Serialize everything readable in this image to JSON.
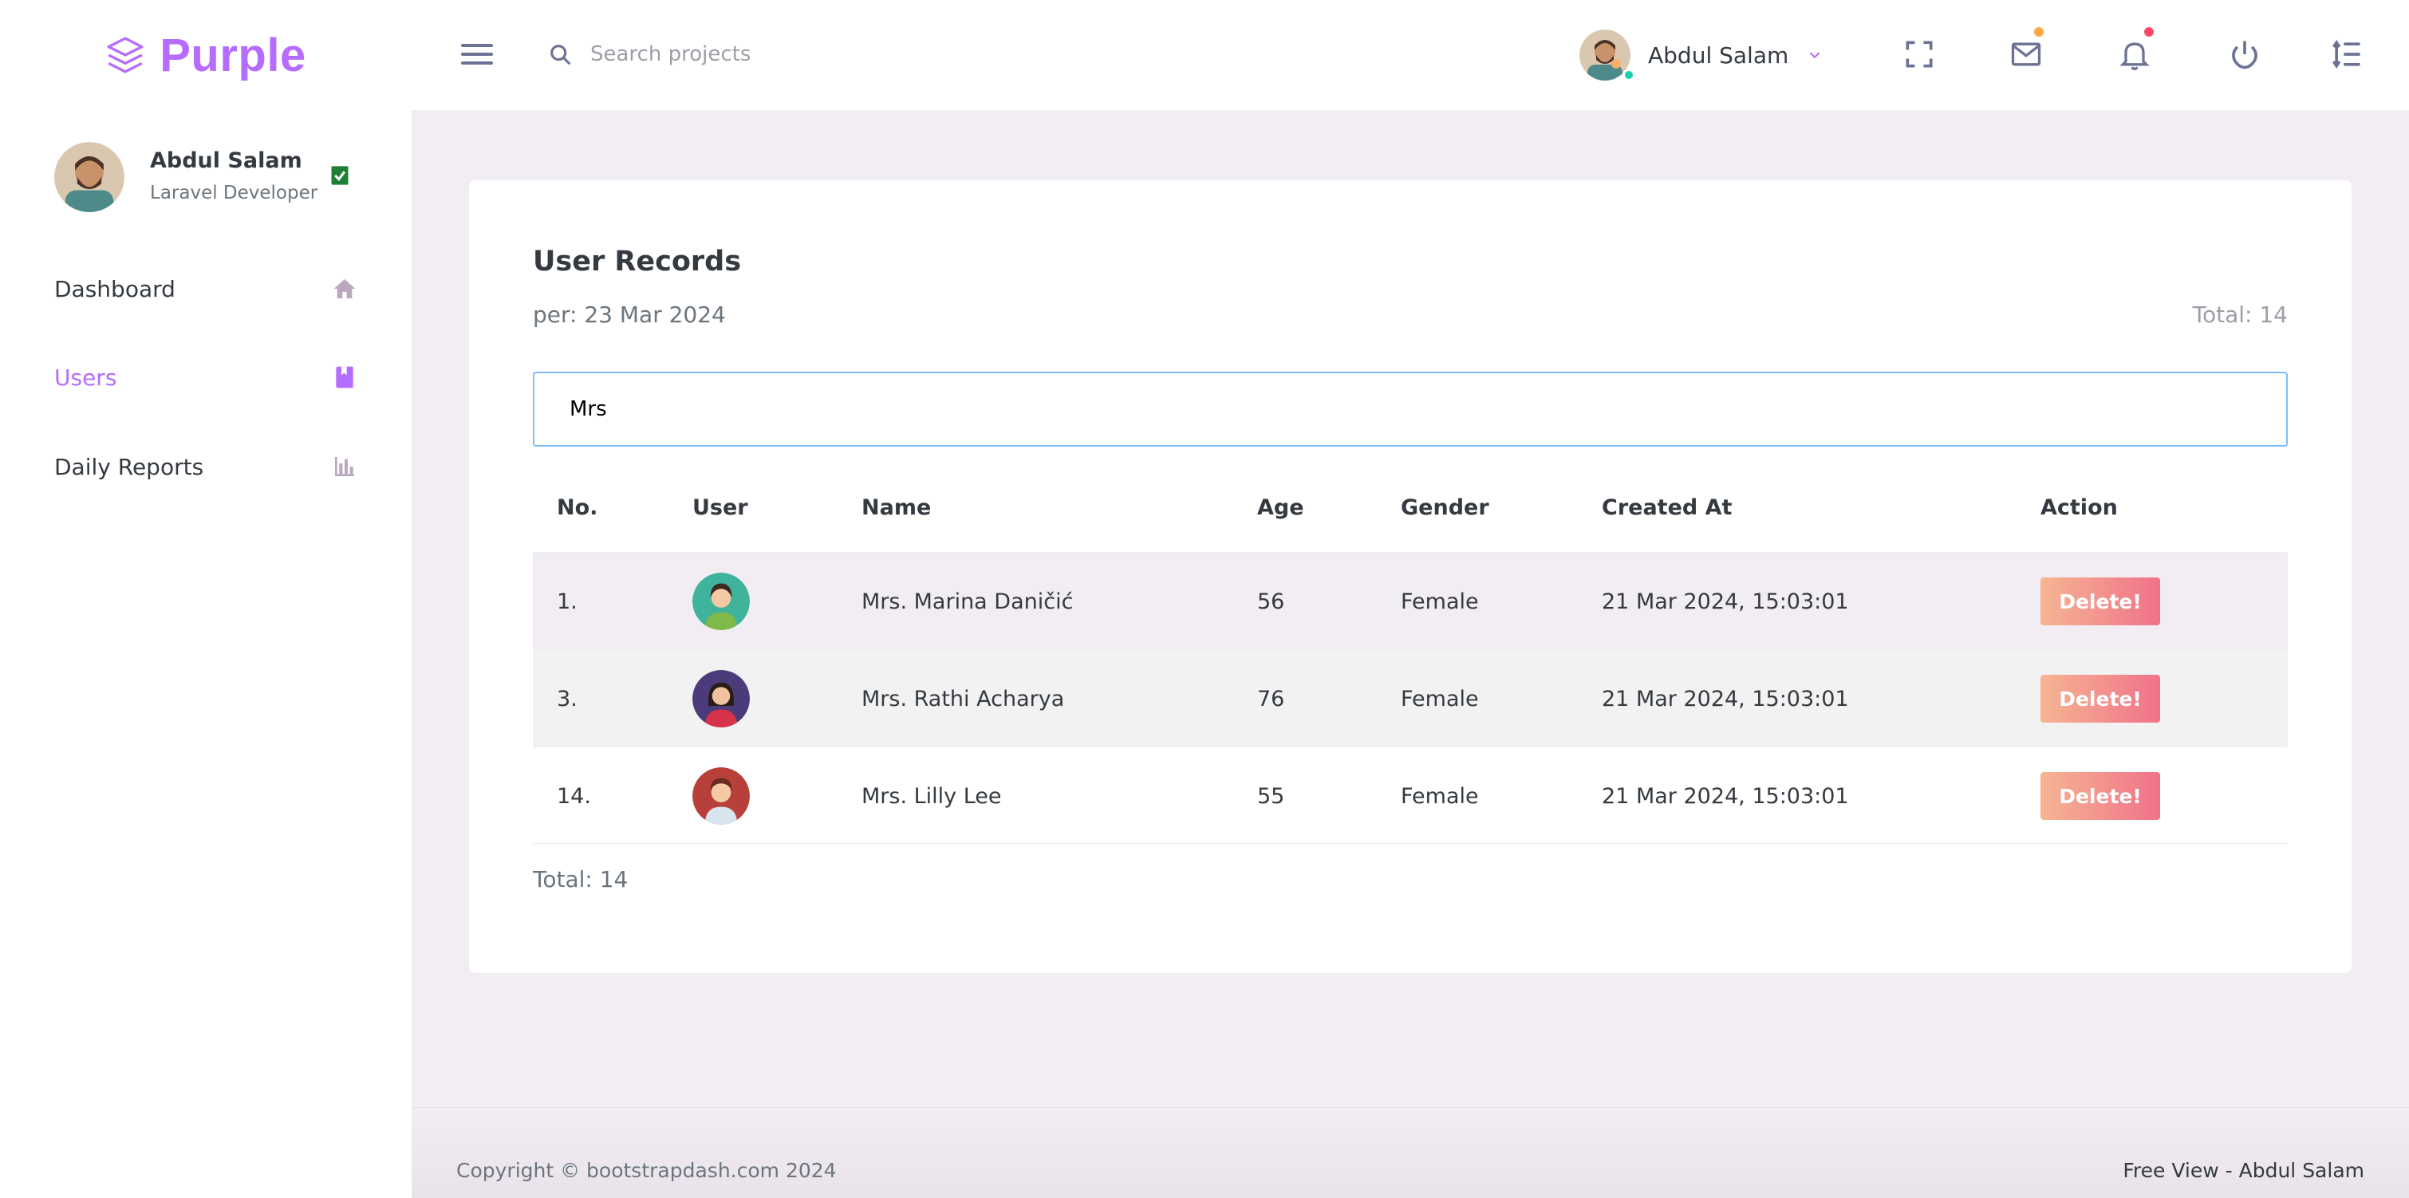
{
  "brand": {
    "name": "Purple",
    "color": "#b66dff"
  },
  "header": {
    "search_placeholder": "Search projects",
    "user_name": "Abdul Salam",
    "icons": [
      "menu-icon",
      "search-icon",
      "fullscreen-icon",
      "mail-icon",
      "bell-icon",
      "power-icon",
      "sidebar-toggle-icon"
    ],
    "notification_dot_colors": {
      "mail": "#fea841",
      "bell": "#fe7c96"
    }
  },
  "sidebar": {
    "profile": {
      "name": "Abdul Salam",
      "role": "Laravel Developer"
    },
    "items": [
      {
        "label": "Dashboard",
        "icon": "home-icon",
        "active": false
      },
      {
        "label": "Users",
        "icon": "book-icon",
        "active": true
      },
      {
        "label": "Daily Reports",
        "icon": "bar-chart-icon",
        "active": false
      }
    ]
  },
  "main": {
    "title": "User Records",
    "per": "per: 23 Mar 2024",
    "total_top": "Total: 14",
    "filter_value": "Mrs",
    "columns": [
      "No.",
      "User",
      "Name",
      "Age",
      "Gender",
      "Created At",
      "Action"
    ],
    "rows": [
      {
        "no": "1.",
        "name": "Mrs. Marina Daničić",
        "age": "56",
        "gender": "Female",
        "created": "21 Mar 2024, 15:03:01",
        "action": "Delete!"
      },
      {
        "no": "3.",
        "name": "Mrs. Rathi Acharya",
        "age": "76",
        "gender": "Female",
        "created": "21 Mar 2024, 15:03:01",
        "action": "Delete!"
      },
      {
        "no": "14.",
        "name": "Mrs. Lilly Lee",
        "age": "55",
        "gender": "Female",
        "created": "21 Mar 2024, 15:03:01",
        "action": "Delete!"
      }
    ],
    "total_bottom": "Total: 14"
  },
  "footer": {
    "copyright": "Copyright © bootstrapdash.com 2024",
    "right": "Free View - Abdul Salam"
  }
}
